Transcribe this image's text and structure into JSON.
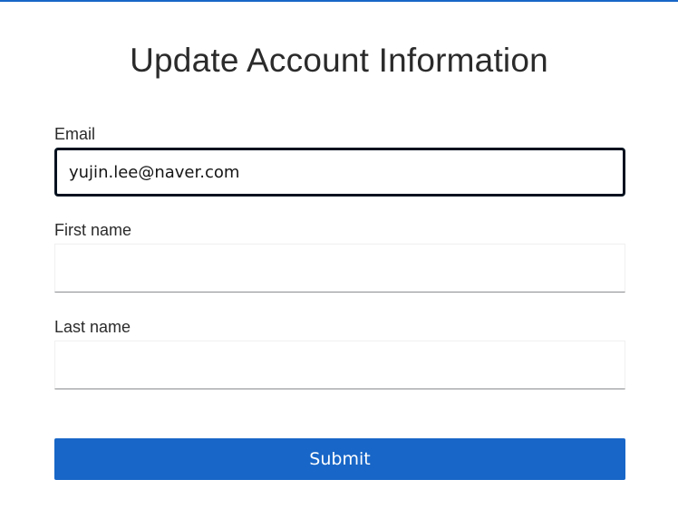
{
  "page": {
    "title": "Update Account Information"
  },
  "form": {
    "email": {
      "label": "Email",
      "value": "yujin.lee@naver.com",
      "placeholder": ""
    },
    "first_name": {
      "label": "First name",
      "value": "",
      "placeholder": ""
    },
    "last_name": {
      "label": "Last name",
      "value": "",
      "placeholder": ""
    },
    "submit_label": "Submit"
  },
  "colors": {
    "accent": "#1866c7",
    "focus_border": "#06121f",
    "input_underline": "#8a8d90"
  }
}
